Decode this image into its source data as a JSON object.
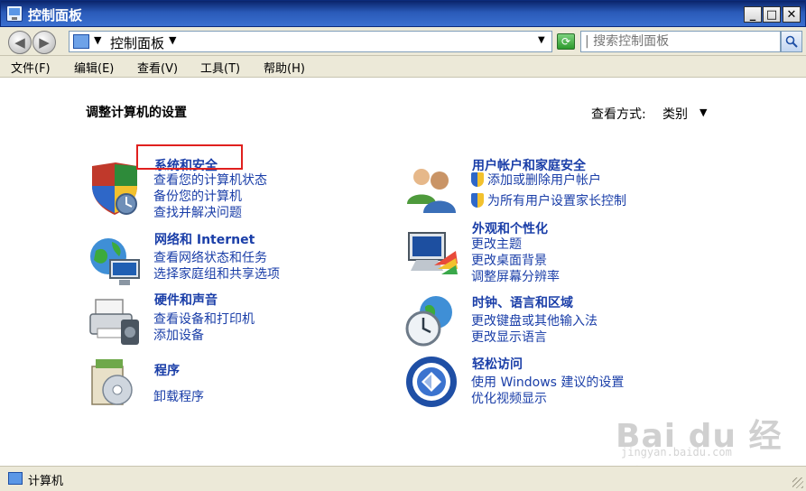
{
  "window": {
    "title": "控制面板"
  },
  "address": {
    "path": "控制面板"
  },
  "search": {
    "placeholder": "| 搜索控制面板"
  },
  "menu": [
    "文件(F)",
    "编辑(E)",
    "查看(V)",
    "工具(T)",
    "帮助(H)"
  ],
  "page": {
    "title": "调整计算机的设置",
    "view_label": "查看方式:",
    "view_value": "类别"
  },
  "categories": [
    {
      "title": "系统和安全",
      "links": [
        "查看您的计算机状态",
        "备份您的计算机",
        "查找并解决问题"
      ]
    },
    {
      "title": "网络和 Internet",
      "links": [
        "查看网络状态和任务",
        "选择家庭组和共享选项"
      ]
    },
    {
      "title": "硬件和声音",
      "links": [
        "查看设备和打印机",
        "添加设备"
      ]
    },
    {
      "title": "程序",
      "links": [
        "卸载程序"
      ]
    },
    {
      "title": "用户帐户和家庭安全",
      "links": [
        "添加或删除用户帐户",
        "为所有用户设置家长控制"
      ]
    },
    {
      "title": "外观和个性化",
      "links": [
        "更改主题",
        "更改桌面背景",
        "调整屏幕分辨率"
      ]
    },
    {
      "title": "时钟、语言和区域",
      "links": [
        "更改键盘或其他输入法",
        "更改显示语言"
      ]
    },
    {
      "title": "轻松访问",
      "links": [
        "使用 Windows 建议的设置",
        "优化视频显示"
      ]
    }
  ],
  "status": {
    "text": "计算机"
  },
  "watermark": {
    "main": "Bai du 经验",
    "sub": "jingyan.baidu.com"
  },
  "colors": {
    "link": "#1a3ea8",
    "highlight": "#e0201e",
    "titlebar": "#2a5ab8"
  },
  "icons": [
    "control-panel-icon",
    "back-icon",
    "forward-icon",
    "refresh-icon",
    "search-icon",
    "computer-icon"
  ]
}
